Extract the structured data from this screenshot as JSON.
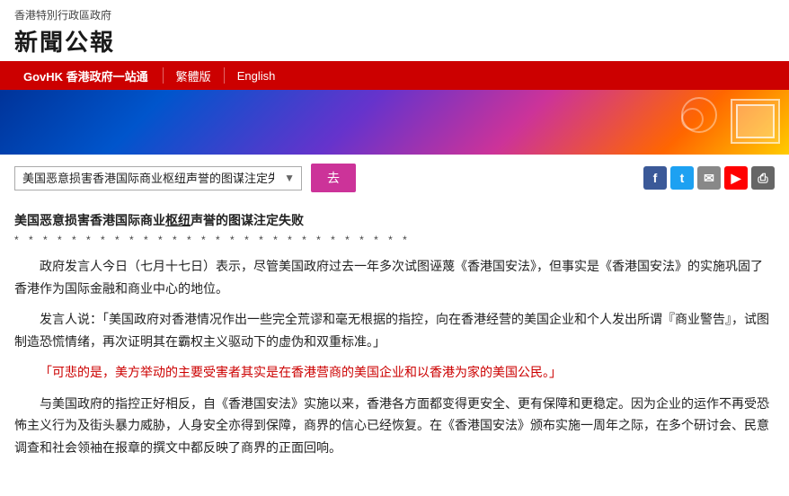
{
  "header": {
    "subtitle": "香港特別行政區政府",
    "title": "新聞公報"
  },
  "nav": {
    "govhk_label": "GovHK 香港政府一站通",
    "traditional_label": "繁體版",
    "english_label": "English"
  },
  "toolbar": {
    "select_value": "美国恶意损害香港国际商业枢纽声誉的图谋注定失败",
    "go_label": "去"
  },
  "social": {
    "fb": "f",
    "tw": "t",
    "email": "✉",
    "youtube": "▶",
    "print": "⎙"
  },
  "article": {
    "title": "美国恶意损害香港国际商业枢纽声誉的图谋注定失败",
    "stars": "* * * * * * * * * * * * * * * * * * * * * * * * * * * *",
    "p1": "政府发言人今日（七月十七日）表示，尽管美国政府过去一年多次试图诬蔑《香港国安法》，但事实是《香港国安法》的实施巩固了香港作为国际金融和商业中心的地位。",
    "p2": "发言人说：「美国政府对香港情况作出一些完全荒谬和毫无根据的指控，向在香港经营的美国企业和个人发出所谓『商业警告』，试图制造恐慌情绪，再次证明其在霸权主义驱动下的虚伪和双重标准。」",
    "quote": "「可悲的是，美方举动的主要受害者其实是在香港营商的美国企业和以香港为家的美国公民。」",
    "p3": "与美国政府的指控正好相反，自《香港国安法》实施以来，香港各方面都变得更安全、更有保障和更稳定。因为企业的运作不再受恐怖主义行为及街头暴力威胁，人身安全亦得到保障，商界的信心已经恢复。在《香港国安法》颁布实施一周年之际，在多个研讨会、民意调查和社会领袖在报章的撰文中都反映了商界的正面回响。"
  }
}
